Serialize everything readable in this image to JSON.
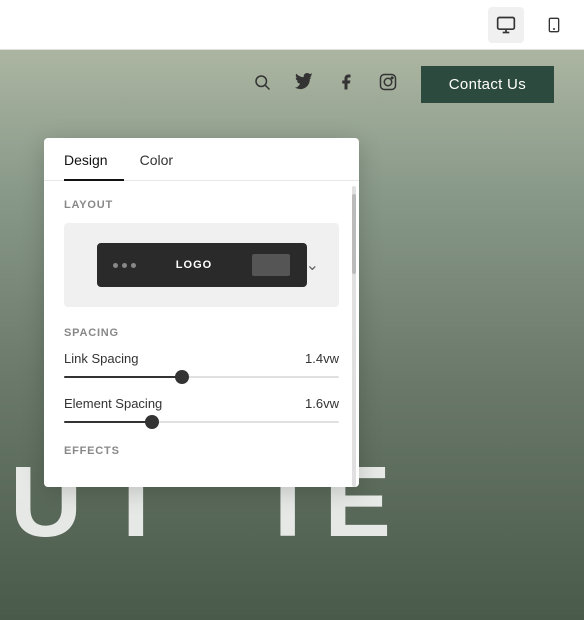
{
  "toolbar": {
    "desktop_icon": "🖥",
    "mobile_icon": "📱"
  },
  "nav": {
    "contact_label": "Contact Us",
    "icons": [
      "search",
      "twitter",
      "facebook",
      "instagram"
    ]
  },
  "hero": {
    "text": "U I T E"
  },
  "panel": {
    "tabs": [
      {
        "label": "Design",
        "active": true
      },
      {
        "label": "Color",
        "active": false
      }
    ],
    "layout_section_label": "Layout",
    "nav_mockup": {
      "logo_text": "LOGO"
    },
    "spacing_section_label": "SPACING",
    "link_spacing_label": "Link Spacing",
    "link_spacing_value": "1.4vw",
    "link_spacing_percent": 43,
    "element_spacing_label": "Element Spacing",
    "element_spacing_value": "1.6vw",
    "element_spacing_percent": 32,
    "effects_section_label": "EFFECTS"
  }
}
